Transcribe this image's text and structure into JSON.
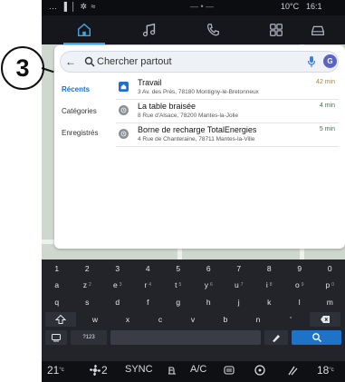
{
  "callout": {
    "label": "3"
  },
  "status": {
    "left": "… ▐ │ ✲ ≈",
    "center": "— • —",
    "temp": "10°C",
    "time": "16:1"
  },
  "nav": {
    "items": [
      "home-icon",
      "music-icon",
      "phone-icon",
      "apps-icon",
      "car-icon"
    ],
    "active": "home-icon"
  },
  "search": {
    "placeholder": "Chercher partout",
    "back": "←",
    "avatar": "G"
  },
  "tabs": [
    "Récents",
    "Catégories",
    "Enregistrés"
  ],
  "results": [
    {
      "name": "Travail",
      "address": "3 Av. des Prés, 78180 Montigny-le-Bretonneux",
      "time": "42 min",
      "icon": "home-icon"
    },
    {
      "name": "La table braisée",
      "address": "8 Rue d'Alsace, 78200 Mantes-la-Jolie",
      "time": "4 min",
      "icon": "history-icon"
    },
    {
      "name": "Borne de recharge TotalEnergies",
      "address": "4 Rue de Chanteraine, 78711 Mantes-la-Ville",
      "time": "5 min",
      "icon": "history-icon"
    }
  ],
  "keyboard": {
    "numbers": [
      "1",
      "2",
      "3",
      "4",
      "5",
      "6",
      "7",
      "8",
      "9",
      "0"
    ],
    "row1": [
      {
        "k": "a",
        "s": ""
      },
      {
        "k": "z",
        "s": "2"
      },
      {
        "k": "e",
        "s": "3"
      },
      {
        "k": "r",
        "s": "4"
      },
      {
        "k": "t",
        "s": "5"
      },
      {
        "k": "y",
        "s": "6"
      },
      {
        "k": "u",
        "s": "7"
      },
      {
        "k": "i",
        "s": "8"
      },
      {
        "k": "o",
        "s": "9"
      },
      {
        "k": "p",
        "s": "0"
      }
    ],
    "row2": [
      "q",
      "s",
      "d",
      "f",
      "g",
      "h",
      "j",
      "k",
      "l",
      "m"
    ],
    "row3": [
      "w",
      "x",
      "c",
      "v",
      "b",
      "n",
      "'"
    ],
    "symbols": "?123"
  },
  "climate": {
    "temp_left": "21",
    "seat": "2",
    "sync": "SYNC",
    "ac": "A/C",
    "temp_right": "18"
  }
}
